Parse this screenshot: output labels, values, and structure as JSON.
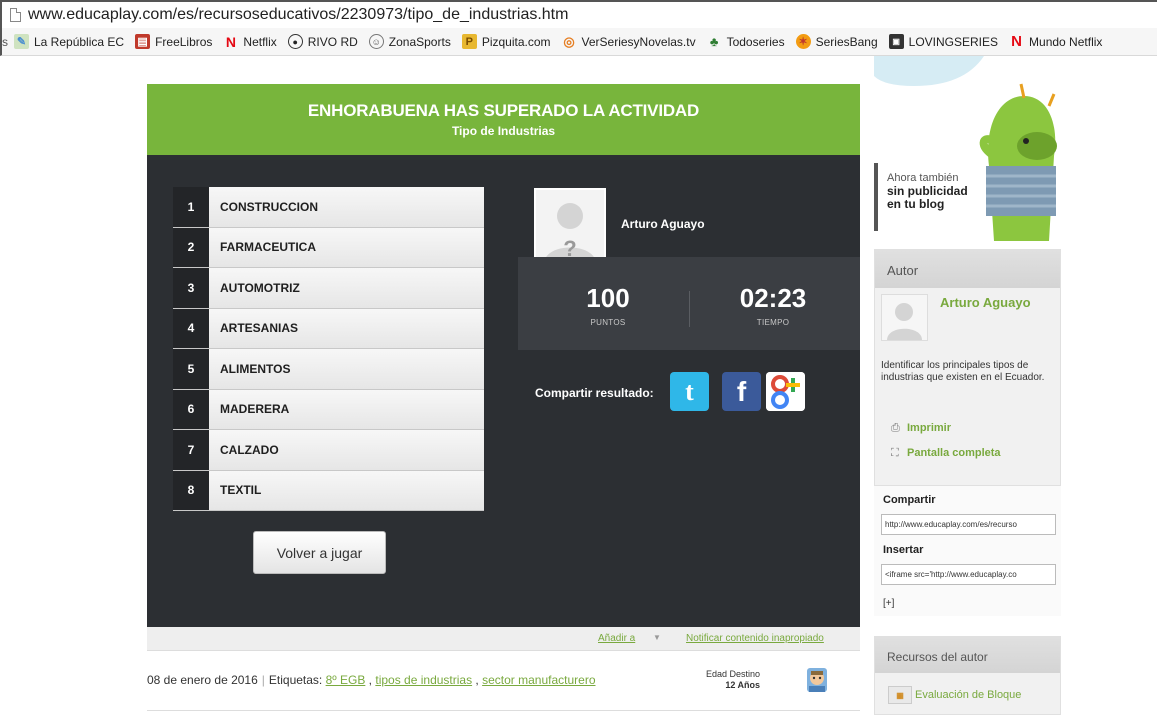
{
  "browser": {
    "url": "www.educaplay.com/es/recursoseducativos/2230973/tipo_de_industrias.htm",
    "bookmarks": [
      {
        "label": "La República EC",
        "icon": "map-icon",
        "color": "#4a8ed0"
      },
      {
        "label": "FreeLibros",
        "icon": "book-icon",
        "color": "#c0392b"
      },
      {
        "label": "Netflix",
        "icon": "netflix-icon",
        "color": "#e50914"
      },
      {
        "label": "RIVO RD",
        "icon": "soccer-ball-icon",
        "color": "#222222"
      },
      {
        "label": "ZonaSports",
        "icon": "smiley-icon",
        "color": "#666666"
      },
      {
        "label": "Pizquita.com",
        "icon": "pizquita-icon",
        "color": "#d9a521"
      },
      {
        "label": "VerSeriesyNovelas.tv",
        "icon": "tv-icon",
        "color": "#e67e22"
      },
      {
        "label": "Todoseries",
        "icon": "todoseries-icon",
        "color": "#2e7d32"
      },
      {
        "label": "SeriesBang",
        "icon": "seriesbang-icon",
        "color": "#e74c3c"
      },
      {
        "label": "LOVINGSERIES",
        "icon": "lovingseries-icon",
        "color": "#333333"
      },
      {
        "label": "Mundo Netflix",
        "icon": "netflix-icon",
        "color": "#e50914"
      }
    ]
  },
  "activity": {
    "title": "ENHORABUENA HAS SUPERADO LA ACTIVIDAD",
    "subtitle": "Tipo de Industrias",
    "answers": [
      {
        "num": "1",
        "label": "CONSTRUCCION"
      },
      {
        "num": "2",
        "label": "FARMACEUTICA"
      },
      {
        "num": "3",
        "label": "AUTOMOTRIZ"
      },
      {
        "num": "4",
        "label": "ARTESANIAS"
      },
      {
        "num": "5",
        "label": "ALIMENTOS"
      },
      {
        "num": "6",
        "label": "MADERERA"
      },
      {
        "num": "7",
        "label": "CALZADO"
      },
      {
        "num": "8",
        "label": "TEXTIL"
      }
    ],
    "replay_label": "Volver a jugar",
    "user_name": "Arturo Aguayo",
    "score": "100",
    "score_label": "PUNTOS",
    "time": "02:23",
    "time_label": "TIEMPO",
    "share_label": "Compartir resultado:"
  },
  "footer": {
    "add_to": "Añadir a",
    "report": "Notificar contenido inapropiado",
    "date": "08 de enero de 2016",
    "tags_label": "Etiquetas:",
    "tags": [
      "8º EGB",
      "tipos de industrias",
      "sector manufacturero"
    ],
    "age_label": "Edad Destino",
    "age_value": "12 Años"
  },
  "sidebar": {
    "promo_line1": "Ahora también",
    "promo_line2": "sin publicidad",
    "promo_line3": "en tu blog",
    "author_title": "Autor",
    "author_name": "Arturo Aguayo",
    "author_desc": "Identificar los principales tipos de industrias que existen en el Ecuador.",
    "print_label": "Imprimir",
    "fullscreen_label": "Pantalla completa",
    "share_title": "Compartir",
    "share_url": "http://www.educaplay.com/es/recurso",
    "embed_title": "Insertar",
    "embed_code": "<iframe src='http://www.educaplay.co",
    "plus_label": "[+]",
    "resources_title": "Recursos del autor",
    "resource_item": "Evaluación de Bloque"
  }
}
